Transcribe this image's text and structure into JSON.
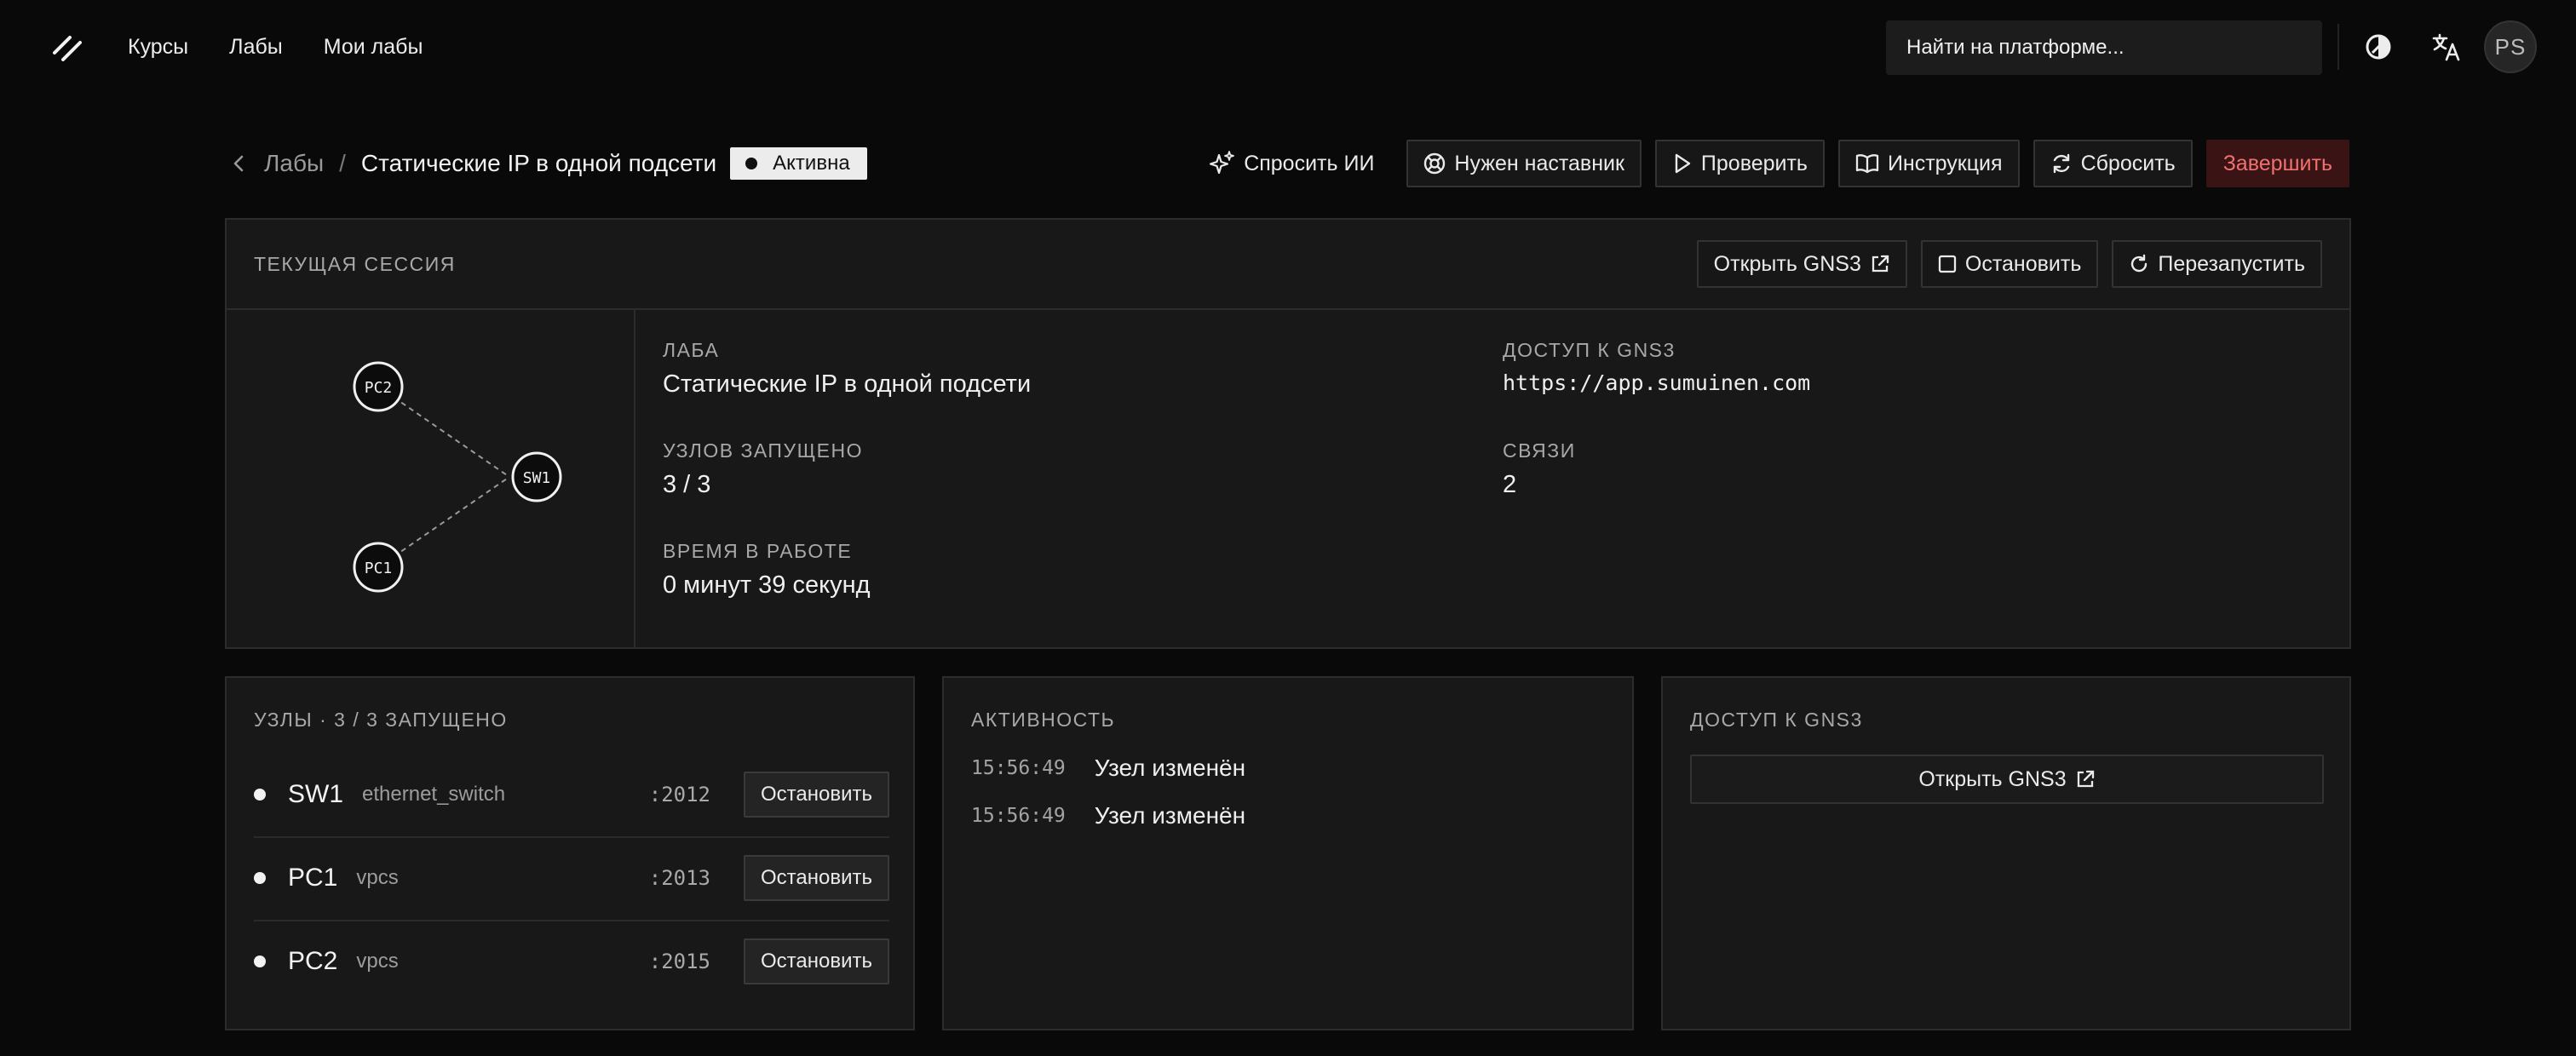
{
  "nav": {
    "links": [
      "Курсы",
      "Лабы",
      "Мои лабы"
    ],
    "search_placeholder": "Найти на платформе...",
    "avatar_initials": "PS",
    "icons": [
      "logo-icon",
      "theme-toggle-icon",
      "translate-icon"
    ]
  },
  "header": {
    "back_label": "Лабы",
    "separator": "/",
    "title": "Статические IP в одной подсети",
    "status": "Активна",
    "actions": {
      "ask_ai": "Спросить ИИ",
      "mentor": "Нужен наставник",
      "check": "Проверить",
      "instructions": "Инструкция",
      "reset": "Сбросить",
      "finish": "Завершить"
    }
  },
  "session": {
    "label": "ТЕКУЩАЯ СЕССИЯ",
    "open_gns3": "Открыть GNS3",
    "stop": "Остановить",
    "restart": "Перезапустить",
    "topology": {
      "nodes": [
        "PC2",
        "SW1",
        "PC1"
      ],
      "links": [
        [
          "PC2",
          "SW1"
        ],
        [
          "PC1",
          "SW1"
        ]
      ]
    },
    "lab_label": "ЛАБА",
    "lab_value": "Статические IP в одной подсети",
    "nodes_running_label": "УЗЛОВ ЗАПУЩЕНО",
    "nodes_running_value": "3 / 3",
    "uptime_label": "ВРЕМЯ В РАБОТЕ",
    "uptime_value": "0 минут 39 секунд",
    "gns_access_label": "ДОСТУП К GNS3",
    "gns_access_value": "https://app.sumuinen.com",
    "links_label": "СВЯЗИ",
    "links_value": "2"
  },
  "nodes_panel": {
    "title": "УЗЛЫ · 3 / 3 ЗАПУЩЕНО",
    "rows": [
      {
        "name": "SW1",
        "type": "ethernet_switch",
        "port": ":2012",
        "action": "Остановить"
      },
      {
        "name": "PC1",
        "type": "vpcs",
        "port": ":2013",
        "action": "Остановить"
      },
      {
        "name": "PC2",
        "type": "vpcs",
        "port": ":2015",
        "action": "Остановить"
      }
    ]
  },
  "activity_panel": {
    "title": "АКТИВНОСТЬ",
    "events": [
      {
        "time": "15:56:49",
        "message": "Узел изменён"
      },
      {
        "time": "15:56:49",
        "message": "Узел изменён"
      }
    ]
  },
  "gns_panel": {
    "title": "ДОСТУП К GNS3",
    "open_label": "Открыть GNS3"
  },
  "colors": {
    "background": "#090909",
    "panel": "#181818",
    "border": "#2c2c2c",
    "danger_bg": "#3a1414",
    "danger_text": "#f07070",
    "status_bg": "#ececec"
  }
}
